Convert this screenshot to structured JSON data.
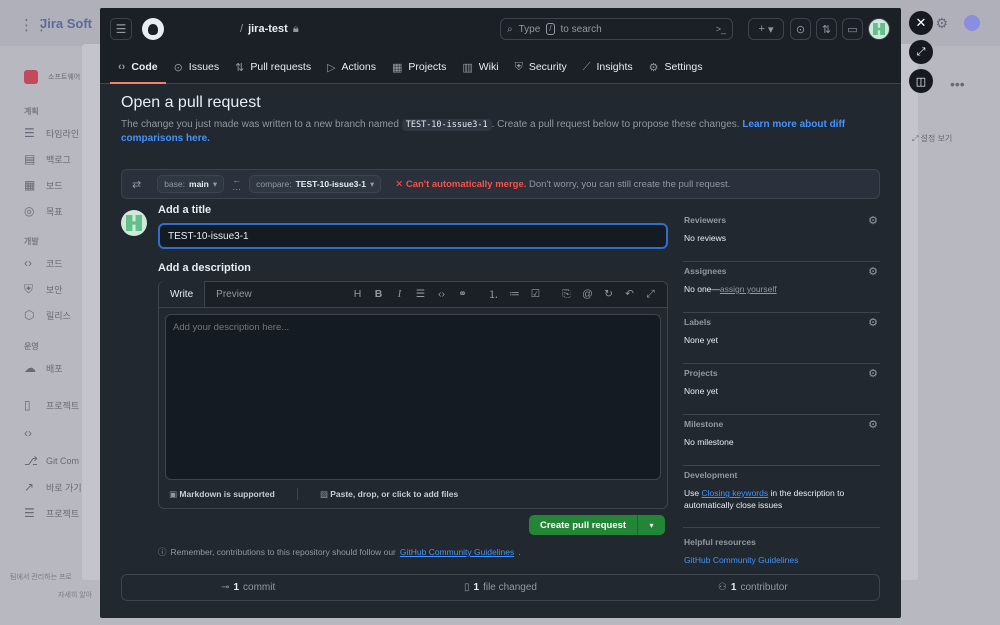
{
  "background": {
    "app_name": "Jira Soft",
    "sidebar_sections": [
      "계획",
      "개발",
      "운영"
    ],
    "sidebar_items": [
      "소프트웨어",
      "타임라인",
      "백로그",
      "보드",
      "목표",
      "코드",
      "보안",
      "릴리스",
      "배포",
      "프로젝트",
      "Git Com",
      "바로 가기",
      "프로젝트"
    ],
    "right_label": "설정 보기",
    "footer_text": "팀에서 관리하는 프로",
    "footer_text2": "자세히 알아"
  },
  "header": {
    "owner_sep": "/",
    "repo": "jira-test",
    "search_text": "Type",
    "search_key": "/",
    "search_suffix": "to search",
    "terminal_icon": "terminal-icon",
    "plus_label": "+"
  },
  "tabs": [
    {
      "label": "Code",
      "icon": "code-icon"
    },
    {
      "label": "Issues",
      "icon": "issue-icon"
    },
    {
      "label": "Pull requests",
      "icon": "pull-request-icon"
    },
    {
      "label": "Actions",
      "icon": "play-icon"
    },
    {
      "label": "Projects",
      "icon": "table-icon"
    },
    {
      "label": "Wiki",
      "icon": "book-icon"
    },
    {
      "label": "Security",
      "icon": "shield-icon"
    },
    {
      "label": "Insights",
      "icon": "graph-icon"
    },
    {
      "label": "Settings",
      "icon": "gear-icon"
    }
  ],
  "page": {
    "title": "Open a pull request",
    "desc_before": "The change you just made was written to a new branch named",
    "branch_code": "TEST-10-issue3-1",
    "desc_after": ". Create a pull request below to propose these changes.",
    "learn_more": "Learn more about diff comparisons here."
  },
  "compare": {
    "base_prefix": "base:",
    "base_value": "main",
    "compare_prefix": "compare:",
    "compare_value": "TEST-10-issue3-1",
    "error_mark": "✕",
    "error_text": "Can't automatically merge.",
    "info_text": "Don't worry, you can still create the pull request."
  },
  "form": {
    "title_label": "Add a title",
    "title_value": "TEST-10-issue3-1",
    "desc_label": "Add a description",
    "write_tab": "Write",
    "preview_tab": "Preview",
    "desc_placeholder": "Add your description here...",
    "markdown_note": "Markdown is supported",
    "attach_note": "Paste, drop, or click to add files",
    "create_label": "Create pull request",
    "reminder_text": "Remember, contributions to this repository should follow our",
    "reminder_link": "GitHub Community Guidelines",
    "reminder_end": "."
  },
  "sidebar": {
    "reviewers_title": "Reviewers",
    "reviewers_val": "No reviews",
    "assignees_title": "Assignees",
    "assignees_val": "No one—",
    "assignees_link": "assign yourself",
    "labels_title": "Labels",
    "labels_val": "None yet",
    "projects_title": "Projects",
    "projects_val": "None yet",
    "milestone_title": "Milestone",
    "milestone_val": "No milestone",
    "development_title": "Development",
    "development_pre": "Use",
    "development_link": "Closing keywords",
    "development_post": "in the description to automatically close issues",
    "resources_title": "Helpful resources",
    "resources_link": "GitHub Community Guidelines"
  },
  "stats": {
    "commits_num": "1",
    "commits_label": "commit",
    "files_num": "1",
    "files_label": "file changed",
    "contrib_num": "1",
    "contrib_label": "contributor"
  }
}
